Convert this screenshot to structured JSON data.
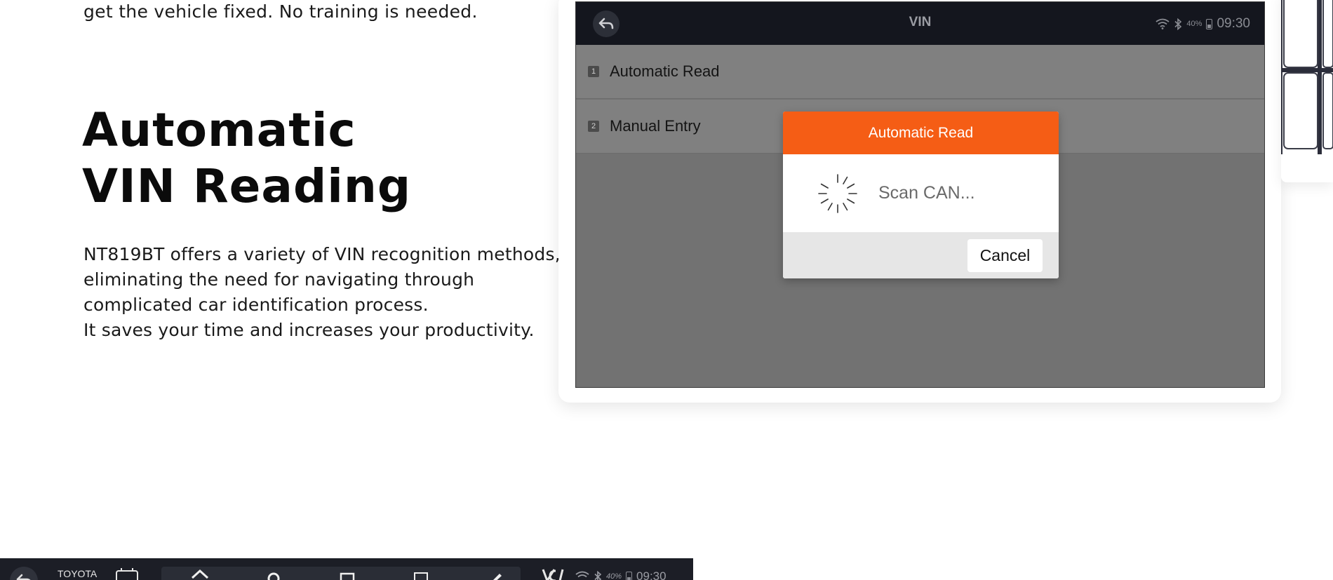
{
  "intro": {
    "tail": "get the vehicle fixed. No training is needed."
  },
  "headline": {
    "line1": "Automatic",
    "line2": "VIN Reading"
  },
  "description": {
    "line1": "NT819BT offers a variety of VIN recognition methods,",
    "line2": "eliminating the need for navigating through",
    "line3": "complicated car identification process.",
    "line4": "It saves your time and increases your productivity."
  },
  "device": {
    "title": "VIN",
    "battery": "40%",
    "time": "09:30",
    "menu": [
      {
        "num": "1",
        "label": "Automatic Read"
      },
      {
        "num": "2",
        "label": "Manual Entry"
      }
    ],
    "dialog": {
      "title": "Automatic Read",
      "message": "Scan CAN...",
      "cancel": "Cancel"
    }
  },
  "bottom_bar": {
    "brand": "TOYOTA",
    "battery": "40%",
    "time": "09:30"
  },
  "colors": {
    "accent": "#f55d15",
    "statusbar": "#14161e",
    "overlay": "#727272"
  },
  "icons": {
    "back": "back-arrow-icon",
    "wifi": "wifi-icon",
    "bluetooth": "bluetooth-icon",
    "battery": "battery-icon",
    "spinner": "loading-spinner-icon"
  }
}
